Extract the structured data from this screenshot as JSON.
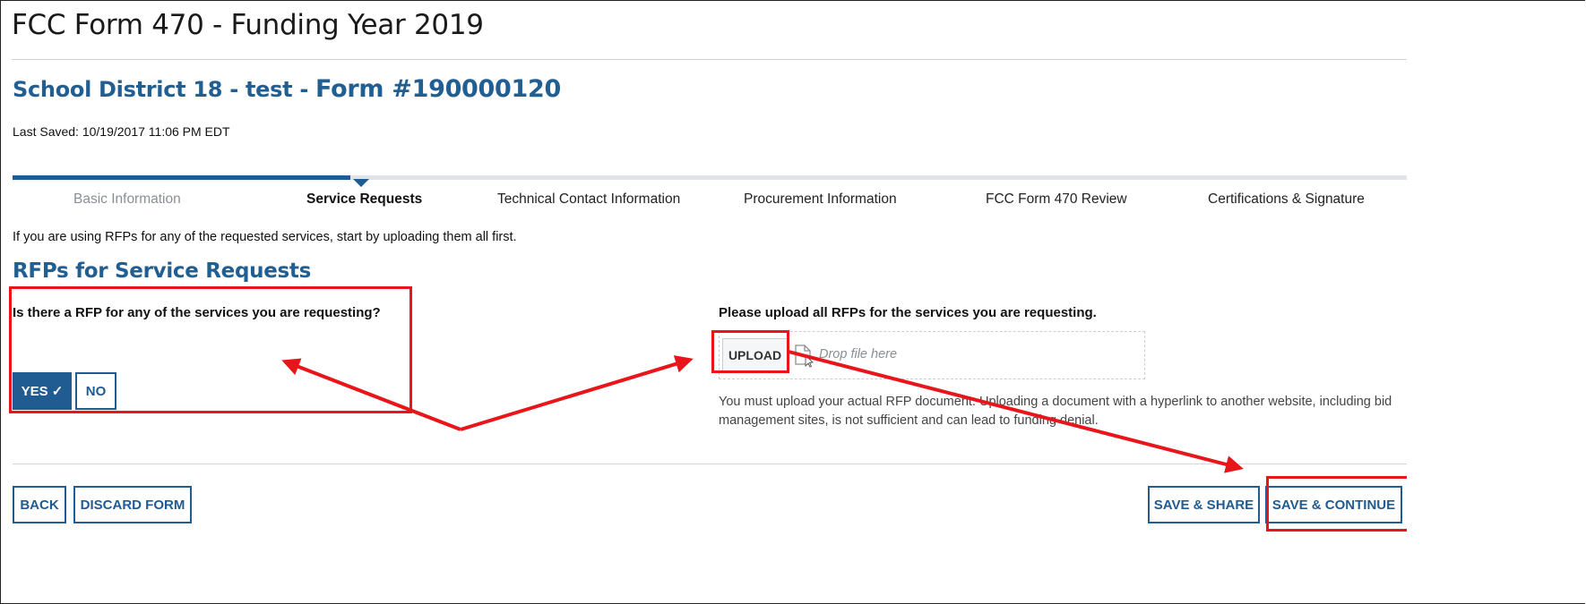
{
  "page": {
    "title": "FCC Form 470 - Funding Year 2019",
    "form_title_prefix": "School District 18 - test - ",
    "form_number": "Form #190000120",
    "last_saved": "Last Saved: 10/19/2017 11:06 PM EDT"
  },
  "steps": [
    {
      "label": "Basic Information",
      "state": "done"
    },
    {
      "label": "Service Requests",
      "state": "active"
    },
    {
      "label": "Technical Contact Information",
      "state": "upcoming"
    },
    {
      "label": "Procurement Information",
      "state": "upcoming"
    },
    {
      "label": "FCC Form 470 Review",
      "state": "upcoming"
    },
    {
      "label": "Certifications & Signature",
      "state": "upcoming"
    }
  ],
  "progress": {
    "completed_steps": 1,
    "total_steps": 6
  },
  "intro_text": "If you are using RFPs for any of the requested services, start by uploading them all first.",
  "section": {
    "title": "RFPs for Service Requests",
    "question": "Is there a RFP for any of the services you are requesting?",
    "yes_label": "YES ✓",
    "no_label": "NO",
    "selected": "yes"
  },
  "upload": {
    "prompt": "Please upload all RFPs for the services you are requesting.",
    "button_label": "UPLOAD",
    "drop_text": "Drop file here",
    "notice": "You must upload your actual RFP document. Uploading a document with a hyperlink to another website, including bid management sites, is not sufficient and can lead to funding denial."
  },
  "footer": {
    "back_label": "BACK",
    "discard_label": "DISCARD FORM",
    "share_label": "SAVE & SHARE",
    "continue_label": "SAVE & CONTINUE"
  },
  "annotation": {
    "color": "#e8161b"
  },
  "colors": {
    "primary": "#205b91",
    "heading": "#215e92"
  }
}
